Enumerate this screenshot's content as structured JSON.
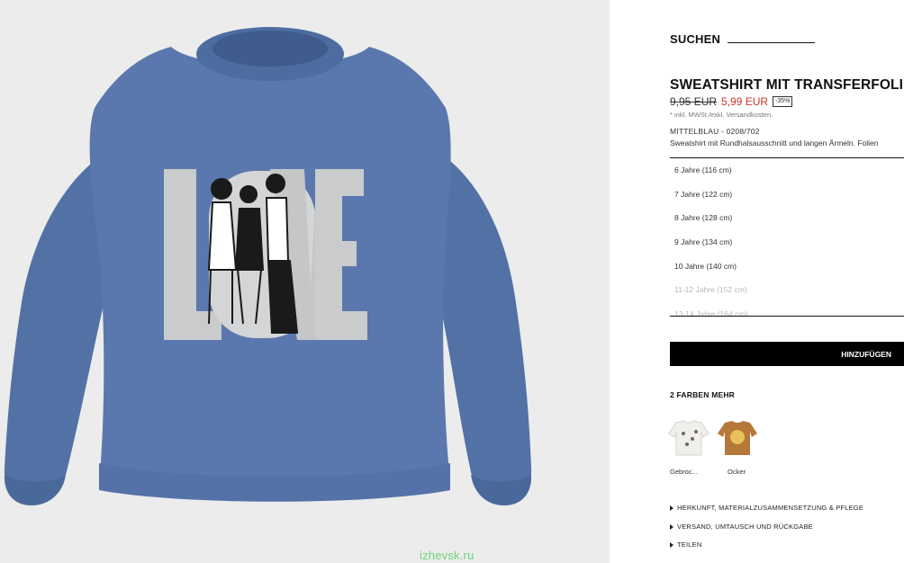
{
  "watermark": "izhevsk.ru",
  "search": {
    "label": "SUCHEN"
  },
  "product": {
    "title": "SWEATSHIRT MIT TRANSFERFOLIE",
    "old_price": "9,95 EUR",
    "new_price": "5,99 EUR",
    "discount": "-35%",
    "tax_note": "* inkl. MWSt./exkl. Versandkosten.",
    "color_ref": "MITTELBLAU - 0208/702",
    "description": "Sweatshirt mit Rundhalsausschnitt und langen Ärmeln. Folien"
  },
  "sizes": [
    {
      "label": "6 Jahre (116 cm)",
      "available": true
    },
    {
      "label": "7 Jahre (122 cm)",
      "available": true
    },
    {
      "label": "8 Jahre (128 cm)",
      "available": true
    },
    {
      "label": "9 Jahre (134 cm)",
      "available": true
    },
    {
      "label": "10 Jahre (140 cm)",
      "available": true
    },
    {
      "label": "11-12 Jahre (152 cm)",
      "available": false
    },
    {
      "label": "13-14 Jahre (164 cm)",
      "available": false
    }
  ],
  "add_button": "HINZUFÜGEN",
  "colors": {
    "heading": "2 FARBEN MEHR",
    "items": [
      {
        "label": "Gebroc...",
        "color": "#f1efe9"
      },
      {
        "label": "Ocker",
        "color": "#b5773a"
      }
    ]
  },
  "accordion": [
    "HERKUNFT, MATERIALZUSAMMENSETZUNG & PFLEGE",
    "VERSAND, UMTAUSCH UND RÜCKGABE",
    "TEILEN"
  ],
  "image": {
    "print_text": "LOVE",
    "garment_color": "#5a78ad",
    "background": "#ececec"
  }
}
